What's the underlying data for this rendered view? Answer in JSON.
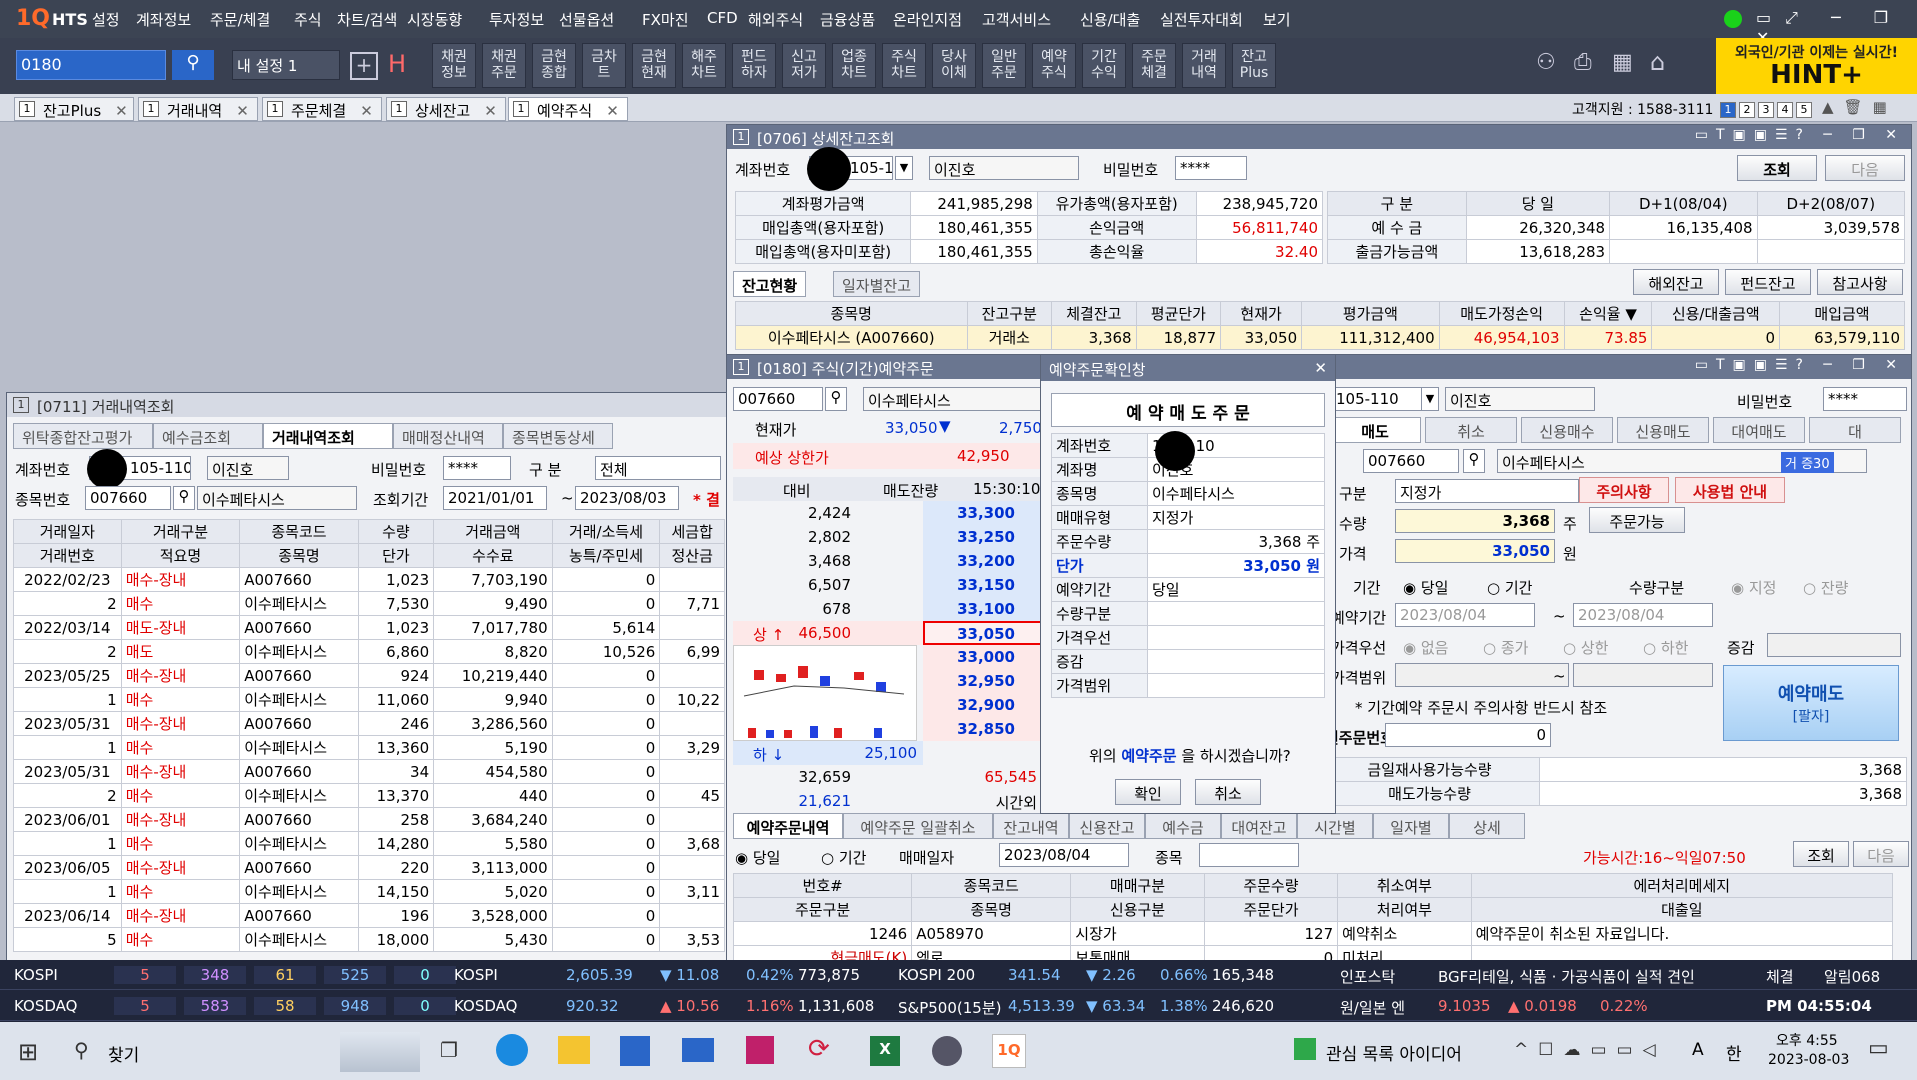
{
  "menubar": {
    "logo": "1Q",
    "logo_sub": "HTS",
    "items": [
      "설정",
      "계좌정보",
      "주문/체결",
      "주식",
      "차트/검색",
      "시장동향",
      "투자정보",
      "선물옵션",
      "FX마진",
      "CFD",
      "해외주식",
      "금융상품",
      "온라인지점",
      "고객서비스",
      "신용/대출",
      "실전투자대회",
      "보기"
    ]
  },
  "toolbar": {
    "code": "0180",
    "preset": "내 설정 1",
    "buttons": [
      "채권\n정보",
      "채권\n주문",
      "금현\n종합",
      "금차\n트",
      "금현\n현재",
      "해주\n차트",
      "펀드\n하자",
      "신고\n저가",
      "업종\n차트",
      "주식\n차트",
      "당사\n이체",
      "일반\n주문",
      "예약\n주식",
      "기간\n수익",
      "주문\n체결",
      "거래\n내역",
      "잔고\nPlus"
    ],
    "hint_top": "외국인/기관 이제는 실시간!",
    "hint_main": "HINT+"
  },
  "tabs": [
    {
      "num": "1",
      "label": "잔고Plus"
    },
    {
      "num": "1",
      "label": "거래내역"
    },
    {
      "num": "1",
      "label": "주문체결"
    },
    {
      "num": "1",
      "label": "상세잔고"
    },
    {
      "num": "1",
      "label": "예약주식"
    }
  ],
  "support": "고객지원 : 1588-3111",
  "pages": [
    "1",
    "2",
    "3",
    "4",
    "5"
  ],
  "balance": {
    "title": "[0706] 상세잔고조회",
    "num": "1",
    "acct_label": "계좌번호",
    "acct": "105-110",
    "name": "이진호",
    "pw_label": "비밀번호",
    "pw": "****",
    "query": "조회",
    "next": "다음",
    "summary": [
      [
        "계좌평가금액",
        "241,985,298",
        "유가총액(용자포함)",
        "238,945,720"
      ],
      [
        "매입총액(용자포함)",
        "180,461,355",
        "손익금액",
        "56,811,740"
      ],
      [
        "매입총액(용자미포함)",
        "180,461,355",
        "총손익율",
        "32.40"
      ]
    ],
    "dep_head": [
      "구 분",
      "당 일",
      "D+1(08/04)",
      "D+2(08/07)"
    ],
    "dep_rows": [
      [
        "예 수 금",
        "26,320,348",
        "16,135,408",
        "3,039,578"
      ],
      [
        "출금가능금액",
        "13,618,283",
        "",
        ""
      ]
    ],
    "subtabs": [
      "잔고현황",
      "일자별잔고"
    ],
    "btns": [
      "해외잔고",
      "펀드잔고",
      "참고사항"
    ],
    "head": [
      "종목명",
      "잔고구분",
      "체결잔고",
      "평균단가",
      "현재가",
      "평가금액",
      "매도가정손익",
      "손익율 ▼",
      "신용/대출금액",
      "매입금액"
    ],
    "row": [
      "이수페타시스 (A007660)",
      "거래소",
      "3,368",
      "18,877",
      "33,050",
      "111,312,400",
      "46,954,103",
      "73.85",
      "0",
      "63,579,110"
    ]
  },
  "history": {
    "title": "[0711] 거래내역조회",
    "num": "1",
    "subtabs": [
      "위탁종합잔고평가",
      "예수금조회",
      "거래내역조회",
      "매매정산내역",
      "종목변동상세"
    ],
    "acct_label": "계좌번호",
    "acct": "105-110",
    "name": "이진호",
    "pw_label": "비밀번호",
    "pw": "****",
    "kind_label": "구 분",
    "kind": "전체",
    "code_label": "종목번호",
    "code": "007660",
    "stock": "이수페타시스",
    "period_label": "조회기간",
    "from": "2021/01/01",
    "to": "2023/08/03",
    "note": "* 결",
    "head1": [
      "거래일자",
      "거래구분",
      "종목코드",
      "수량",
      "거래금액",
      "거래/소득세",
      "세금합"
    ],
    "head2": [
      "거래번호",
      "적요명",
      "종목명",
      "단가",
      "수수료",
      "농특/주민세",
      "정산금"
    ],
    "rows": [
      [
        "2022/02/23",
        "매수-장내",
        "A007660",
        "1,023",
        "7,703,190",
        "0",
        ""
      ],
      [
        "2",
        "매수",
        "이수페타시스",
        "7,530",
        "9,490",
        "0",
        "7,71"
      ],
      [
        "2022/03/14",
        "매도-장내",
        "A007660",
        "1,023",
        "7,017,780",
        "5,614",
        ""
      ],
      [
        "2",
        "매도",
        "이수페타시스",
        "6,860",
        "8,820",
        "10,526",
        "6,99"
      ],
      [
        "2023/05/25",
        "매수-장내",
        "A007660",
        "924",
        "10,219,440",
        "0",
        ""
      ],
      [
        "1",
        "매수",
        "이수페타시스",
        "11,060",
        "9,940",
        "0",
        "10,22"
      ],
      [
        "2023/05/31",
        "매수-장내",
        "A007660",
        "246",
        "3,286,560",
        "0",
        ""
      ],
      [
        "1",
        "매수",
        "이수페타시스",
        "13,360",
        "5,190",
        "0",
        "3,29"
      ],
      [
        "2023/05/31",
        "매수-장내",
        "A007660",
        "34",
        "454,580",
        "0",
        ""
      ],
      [
        "2",
        "매수",
        "이수페타시스",
        "13,370",
        "440",
        "0",
        "45"
      ],
      [
        "2023/06/01",
        "매수-장내",
        "A007660",
        "258",
        "3,684,240",
        "0",
        ""
      ],
      [
        "1",
        "매수",
        "이수페타시스",
        "14,280",
        "5,580",
        "0",
        "3,68"
      ],
      [
        "2023/06/05",
        "매수-장내",
        "A007660",
        "220",
        "3,113,000",
        "0",
        ""
      ],
      [
        "1",
        "매수",
        "이수페타시스",
        "14,150",
        "5,020",
        "0",
        "3,11"
      ],
      [
        "2023/06/14",
        "매수-장내",
        "A007660",
        "196",
        "3,528,000",
        "0",
        ""
      ],
      [
        "5",
        "매수",
        "이수페타시스",
        "18,000",
        "5,430",
        "0",
        "3,53"
      ]
    ]
  },
  "order": {
    "title": "[0180] 주식(기간)예약주문",
    "num": "1",
    "code": "007660",
    "stock": "이수페타시스",
    "cur_label": "현재가",
    "cur": "33,050",
    "chg": "2,750",
    "limit_label": "예상 상한가",
    "limit": "42,950",
    "ob_head": [
      "대비",
      "매도잔량",
      "15:30:10"
    ],
    "asks": [
      [
        "2,424",
        "33,300"
      ],
      [
        "2,802",
        "33,250"
      ],
      [
        "3,468",
        "33,200"
      ],
      [
        "6,507",
        "33,150"
      ],
      [
        "678",
        "33,100"
      ]
    ],
    "upper": "상 ↑",
    "upper_val": "46,500",
    "mid": "33,050",
    "bids": [
      "33,000",
      "32,950",
      "32,900",
      "32,850"
    ],
    "lower": "하 ↓",
    "lower_val": "25,100",
    "tot1": [
      "32,659",
      "65,545"
    ],
    "tot2": [
      "21,621",
      "시간외"
    ],
    "acct": "105-110",
    "name": "이진호",
    "pw_label": "비밀번호",
    "pw": "****",
    "rtabs": [
      "매도",
      "취소",
      "신용매수",
      "신용매도",
      "대여매도",
      "대"
    ],
    "rcode": "007660",
    "rstock": "이수페타시스",
    "badge": "거 증30",
    "type_label": "구분",
    "type": "지정가",
    "warn": "주의사항",
    "guide": "사용법 안내",
    "qty_label": "수량",
    "qty": "3,368",
    "qty_unit": "주",
    "possible": "주문가능",
    "price_label": "가격",
    "price": "33,050",
    "price_unit": "원",
    "term_label": "기간",
    "today": "당일",
    "period": "기간",
    "qtykind_label": "수량구분",
    "fixed": "지정",
    "remain": "잔량",
    "dur_label": "예약기간",
    "d1": "2023/08/04",
    "d2": "2023/08/04",
    "prio_label": "가격우선",
    "none": "없음",
    "close": "종가",
    "hi": "상한",
    "lo": "하한",
    "inc_label": "증감",
    "range_label": "가격범위",
    "notice": "* 기간예약 주문시 주의사항 반드시 참조",
    "sell_btn": "예약매도",
    "sell_sub": "[팔자]",
    "no_label": "원주문번호",
    "no": "0",
    "avail1_label": "금일재사용가능수량",
    "avail1": "3,368",
    "avail2_label": "매도가능수량",
    "avail2": "3,368",
    "btabs": [
      "예약주문내역",
      "예약주문 일괄취소",
      "잔고내역",
      "신용잔고",
      "예수금",
      "대여잔고",
      "시간별",
      "일자별",
      "상세"
    ],
    "bdate_label": "매매일자",
    "bdate": "2023/08/04",
    "bstock_label": "종목",
    "btime": "가능시간:16~익일07:50",
    "bquery": "조회",
    "bnext": "다음",
    "bhead1": [
      "번호#",
      "종목코드",
      "매매구분",
      "주문수량",
      "취소여부",
      "에러처리메세지"
    ],
    "bhead2": [
      "주문구분",
      "종목명",
      "신용구분",
      "주문단가",
      "처리여부",
      "대출일"
    ],
    "brow": [
      "1246",
      "A058970",
      "시장가",
      "127",
      "예약취소",
      "예약주문이 취소된 자료입니다."
    ],
    "brow2": [
      "현금매도(K)",
      "엠로",
      "보통매매",
      "0",
      "미처리",
      ""
    ]
  },
  "confirm": {
    "title": "예약주문확인창",
    "heading": "예 약 매 도 주 문",
    "rows": [
      [
        "계좌번호",
        "105-110"
      ],
      [
        "계좌명",
        "이진호"
      ],
      [
        "종목명",
        "이수페타시스"
      ],
      [
        "매매유형",
        "지정가"
      ],
      [
        "주문수량",
        "3,368 주"
      ],
      [
        "단가",
        "33,050 원"
      ],
      [
        "예약기간",
        "당일"
      ],
      [
        "수량구분",
        ""
      ],
      [
        "가격우선",
        ""
      ],
      [
        "증감",
        ""
      ],
      [
        "가격범위",
        ""
      ]
    ],
    "question_pre": "위의 ",
    "question_em": "예약주문",
    "question_post": " 을 하시겠습니까?",
    "ok": "확인",
    "cancel": "취소"
  },
  "ticker": {
    "row1": {
      "name": "KOSPI",
      "b": [
        "5",
        "348",
        "61",
        "525",
        "0"
      ],
      "idx": "KOSPI",
      "val": "2,605.39",
      "chg": "▼ 11.08",
      "pct": "0.42%",
      "vol": "773,875",
      "idx2": "KOSPI 200",
      "val2": "341.54",
      "chg2": "▼ 2.26",
      "pct2": "0.66%",
      "vol2": "165,348",
      "news_src": "인포스탁",
      "news": "BGF리테일, 식품 · 가공식품이 실적 견인"
    },
    "row2": {
      "name": "KOSDAQ",
      "b": [
        "5",
        "583",
        "58",
        "948",
        "0"
      ],
      "idx": "KOSDAQ",
      "val": "920.32",
      "chg": "▲ 10.56",
      "pct": "1.16%",
      "vol": "1,131,608",
      "idx2": "S&P500(15분)",
      "val2": "4,513.39",
      "chg2": "▼ 63.34",
      "pct2": "1.38%",
      "vol2": "246,620",
      "fx_label": "원/일본 엔",
      "fx": "9.1035",
      "fxchg": "▲ 0.0198",
      "fxpct": "0.22%"
    },
    "right_tabs": [
      "체결",
      "알림068"
    ],
    "clock": "PM 04:55:04"
  },
  "taskbar": {
    "search": "찾기",
    "tray_text": "관심 목록 아이디어",
    "ime": "A",
    "lang": "한",
    "time": "오후 4:55",
    "date": "2023-08-03"
  }
}
